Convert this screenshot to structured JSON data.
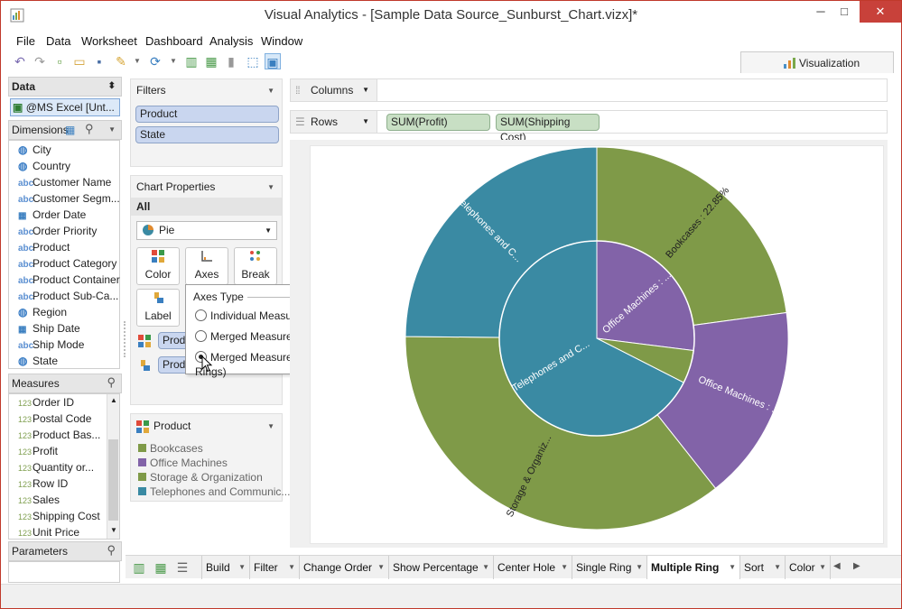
{
  "window": {
    "title": "Visual Analytics - [Sample Data Source_Sunburst_Chart.vizx]*",
    "minimize": "─",
    "maximize": "□",
    "close": "✕"
  },
  "menu": [
    "File",
    "Data",
    "Worksheet",
    "Dashboard",
    "Analysis",
    "Window"
  ],
  "toolbar_right_tab": "Visualization",
  "data_panel": {
    "header": "Data",
    "source": "@MS Excel [Unt...",
    "dimensions_header": "Dimensions",
    "dimensions": [
      {
        "type": "globe",
        "icon": "🌐",
        "label": "City"
      },
      {
        "type": "globe",
        "icon": "🌐",
        "label": "Country"
      },
      {
        "type": "abc",
        "icon": "abc",
        "label": "Customer Name"
      },
      {
        "type": "abc",
        "icon": "abc",
        "label": "Customer Segm..."
      },
      {
        "type": "date",
        "icon": "📅",
        "label": "Order Date"
      },
      {
        "type": "abc",
        "icon": "abc",
        "label": "Order Priority"
      },
      {
        "type": "abc",
        "icon": "abc",
        "label": "Product"
      },
      {
        "type": "abc",
        "icon": "abc",
        "label": "Product Category"
      },
      {
        "type": "abc",
        "icon": "abc",
        "label": "Product Container"
      },
      {
        "type": "abc",
        "icon": "abc",
        "label": "Product Sub-Ca..."
      },
      {
        "type": "globe",
        "icon": "🌐",
        "label": "Region"
      },
      {
        "type": "date",
        "icon": "📅",
        "label": "Ship Date"
      },
      {
        "type": "abc",
        "icon": "abc",
        "label": "Ship Mode"
      },
      {
        "type": "globe",
        "icon": "🌐",
        "label": "State"
      }
    ],
    "measures_header": "Measures",
    "measures": [
      {
        "icon": "123",
        "label": "Order ID"
      },
      {
        "icon": "123",
        "label": "Postal Code"
      },
      {
        "icon": "123",
        "label": "Product Bas..."
      },
      {
        "icon": "123",
        "label": "Profit"
      },
      {
        "icon": "123",
        "label": "Quantity or..."
      },
      {
        "icon": "123",
        "label": "Row ID"
      },
      {
        "icon": "123",
        "label": "Sales"
      },
      {
        "icon": "123",
        "label": "Shipping Cost"
      },
      {
        "icon": "123",
        "label": "Unit Price"
      }
    ],
    "parameters_header": "Parameters"
  },
  "filters": {
    "header": "Filters",
    "items": [
      "Product",
      "State"
    ]
  },
  "chart_properties": {
    "header": "Chart Properties",
    "scope": "All",
    "chart_type": "Pie",
    "buttons": {
      "color": "Color",
      "axes": "Axes",
      "break": "Break",
      "label": "Label"
    },
    "color_pill": "Produ",
    "label_pill": "Produ"
  },
  "axes_popup": {
    "title": "Axes Type",
    "options": [
      "Individual Measures",
      "Merged Measures (Single Ring)",
      "Merged Measures (Multiple Rings)"
    ],
    "selected_index": 2
  },
  "legend": {
    "header": "Product",
    "items": [
      {
        "label": "Bookcases",
        "color": "#7f9a48"
      },
      {
        "label": "Office Machines",
        "color": "#8263a8"
      },
      {
        "label": "Storage & Organization",
        "color": "#7f9a48"
      },
      {
        "label": "Telephones and Communic...",
        "color": "#3a8aa3"
      }
    ]
  },
  "shelves": {
    "columns_label": "Columns",
    "rows_label": "Rows",
    "rows_pills": [
      "SUM(Profit)",
      "SUM(Shipping Cost)"
    ]
  },
  "chart_data": {
    "type": "pie",
    "title": "",
    "series": [
      {
        "ring": "outer",
        "measure": "SUM(Shipping Cost)",
        "slices": [
          {
            "category": "Bookcases",
            "share": 22.85,
            "label": "Bookcases : 22.85%"
          },
          {
            "category": "Office Machines",
            "share": 16.5,
            "label": "Office Machines : ..."
          },
          {
            "category": "Storage & Organization",
            "share": 35.8,
            "label": "Storage & Organiz..."
          },
          {
            "category": "Telephones and Communication",
            "share": 24.85,
            "label": "Telephones and C..."
          }
        ]
      },
      {
        "ring": "inner",
        "measure": "SUM(Profit)",
        "slices": [
          {
            "category": "Bookcases",
            "share": 0.0,
            "label": ""
          },
          {
            "category": "Office Machines",
            "share": 27.0,
            "label": "Office Machines : ..."
          },
          {
            "category": "Storage & Organization",
            "share": 5.5,
            "label": ""
          },
          {
            "category": "Telephones and Communication",
            "share": 67.5,
            "label": "Telephones and C..."
          }
        ]
      }
    ],
    "colors": {
      "Bookcases": "#7f9a48",
      "Office Machines": "#8263a8",
      "Storage & Organization": "#7f9a48",
      "Telephones and Communication": "#3a8aa3"
    }
  },
  "bottom_tabs": [
    {
      "label": "Build",
      "active": false
    },
    {
      "label": "Filter",
      "active": false
    },
    {
      "label": "Change Order",
      "active": false
    },
    {
      "label": "Show Percentage",
      "active": false
    },
    {
      "label": "Center Hole",
      "active": false
    },
    {
      "label": "Single Ring",
      "active": false
    },
    {
      "label": "Multiple Ring",
      "active": true
    },
    {
      "label": "Sort",
      "active": false
    },
    {
      "label": "Color",
      "active": false
    }
  ]
}
